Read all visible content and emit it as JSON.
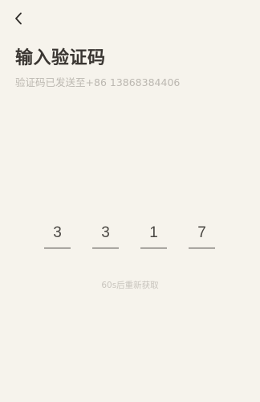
{
  "header": {
    "back_icon": "chevron-left-icon"
  },
  "title": "输入验证码",
  "subtitle": {
    "prefix": "验证码已发送至",
    "phone": "+86 13868384406"
  },
  "code": {
    "digits": [
      "3",
      "3",
      "1",
      "7"
    ]
  },
  "resend": {
    "countdown_label": "60s后重新获取"
  },
  "colors": {
    "background": "#f6f3ec",
    "title": "#3a3632",
    "subtitle": "#bcb8b1",
    "digit": "#4a4743",
    "resend": "#c8c4bd"
  }
}
